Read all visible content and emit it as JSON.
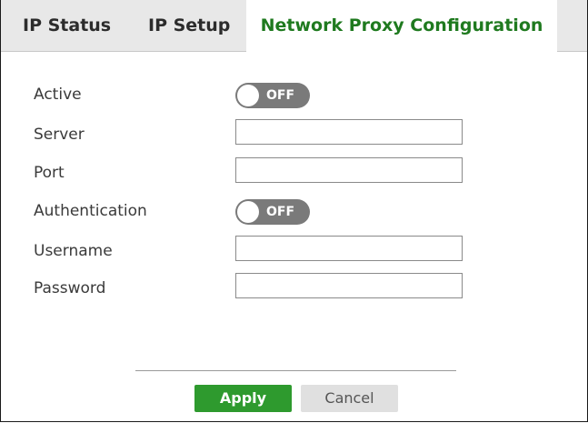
{
  "tabs": [
    {
      "label": "IP Status"
    },
    {
      "label": "IP Setup"
    },
    {
      "label": "Network Proxy Configuration"
    }
  ],
  "form": {
    "active_label": "Active",
    "active_toggle": "OFF",
    "server_label": "Server",
    "server_value": "",
    "port_label": "Port",
    "port_value": "",
    "auth_label": "Authentication",
    "auth_toggle": "OFF",
    "username_label": "Username",
    "username_value": "",
    "password_label": "Password",
    "password_value": ""
  },
  "buttons": {
    "apply": "Apply",
    "cancel": "Cancel"
  },
  "colors": {
    "active_tab_text": "#1f7a1f",
    "apply_bg": "#2e9a2e",
    "toggle_off_bg": "#7a7a7a"
  }
}
